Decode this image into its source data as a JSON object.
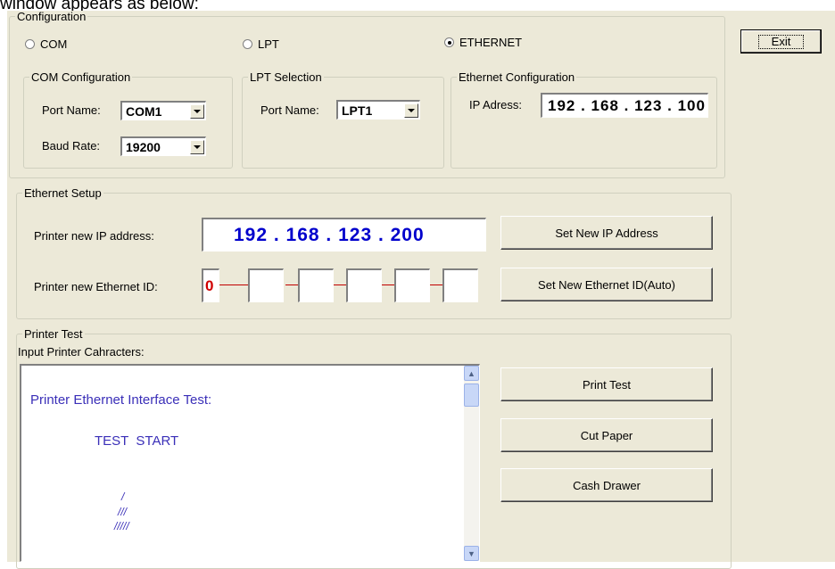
{
  "heading": "window appears as below:",
  "configuration": {
    "legend": "Configuration",
    "radios": [
      {
        "label": "COM",
        "selected": false
      },
      {
        "label": "LPT",
        "selected": false
      },
      {
        "label": "ETHERNET",
        "selected": true
      }
    ],
    "com": {
      "legend": "COM Configuration",
      "port_label": "Port Name:",
      "port_value": "COM1",
      "baud_label": "Baud Rate:",
      "baud_value": "19200"
    },
    "lpt": {
      "legend": "LPT Selection",
      "port_label": "Port Name:",
      "port_value": "LPT1"
    },
    "ethernet": {
      "legend": "Ethernet Configuration",
      "ip_label": "IP Adress:",
      "ip_value": "192 . 168 . 123 . 100"
    }
  },
  "exit_button": "Exit",
  "ethernet_setup": {
    "legend": "Ethernet Setup",
    "ip_label": "Printer new IP address:",
    "ip_value": "192 . 168 . 123 . 200",
    "set_ip_button": "Set New IP Address",
    "id_label": "Printer new Ethernet ID:",
    "id_values": [
      "0",
      "",
      "",
      "",
      "",
      ""
    ],
    "set_id_button": "Set New Ethernet ID(Auto)"
  },
  "printer_test": {
    "legend": "Printer Test",
    "input_label": "Input Printer Cahracters:",
    "text_lines": [
      "Printer Ethernet Interface Test:",
      "TEST  START",
      "/",
      "///",
      "/////"
    ],
    "buttons": {
      "print_test": "Print Test",
      "cut_paper": "Cut Paper",
      "cash_drawer": "Cash Drawer"
    }
  },
  "colors": {
    "window_bg": "#ece9d8",
    "ip_highlight": "#0000cc",
    "id_accent": "#d00000",
    "test_text": "#3a2fb8"
  }
}
